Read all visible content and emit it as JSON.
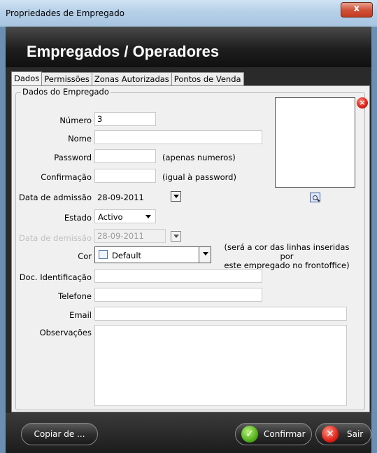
{
  "window": {
    "title": "Propriedades de Empregado",
    "close_glyph": "x"
  },
  "header": {
    "title": "Empregados / Operadores"
  },
  "tabs": [
    {
      "label": "Dados",
      "active": true
    },
    {
      "label": "Permissões",
      "active": false
    },
    {
      "label": "Zonas Autorizadas",
      "active": false
    },
    {
      "label": "Pontos de Venda",
      "active": false
    }
  ],
  "group": {
    "legend": "Dados do Empregado"
  },
  "form": {
    "numero": {
      "label": "Número",
      "value": "3"
    },
    "nome": {
      "label": "Nome",
      "value": ""
    },
    "password": {
      "label": "Password",
      "value": "",
      "hint": "(apenas numeros)"
    },
    "confirmacao": {
      "label": "Confirmação",
      "value": "",
      "hint": "(igual à password)"
    },
    "data_admissao": {
      "label": "Data de admissão",
      "value": "28-09-2011"
    },
    "estado": {
      "label": "Estado",
      "value": "Activo"
    },
    "data_demissao": {
      "label": "Data de demissão",
      "value": "28-09-2011",
      "disabled": true
    },
    "cor": {
      "label": "Cor",
      "value": "Default",
      "hint_line1": "(será a cor das linhas inseridas por",
      "hint_line2": "este empregado no frontoffice)"
    },
    "doc_identificacao": {
      "label": "Doc. Identificação",
      "value": ""
    },
    "telefone": {
      "label": "Telefone",
      "value": ""
    },
    "email": {
      "label": "Email",
      "value": ""
    },
    "observacoes": {
      "label": "Observações",
      "value": ""
    }
  },
  "photo": {
    "remove_icon": "remove-icon",
    "zoom_icon": "zoom-icon",
    "remove_glyph": "×"
  },
  "buttons": {
    "copy_label": "Copiar de ...",
    "confirm_label": "Confirmar",
    "confirm_glyph": "✓",
    "exit_label": "Sair",
    "exit_glyph": "✕"
  },
  "colors": {
    "header_bg": "#1e1e1e",
    "titlebar_bg": "#b6d0e8",
    "accent_green": "#55b21e",
    "accent_red": "#e32219"
  }
}
